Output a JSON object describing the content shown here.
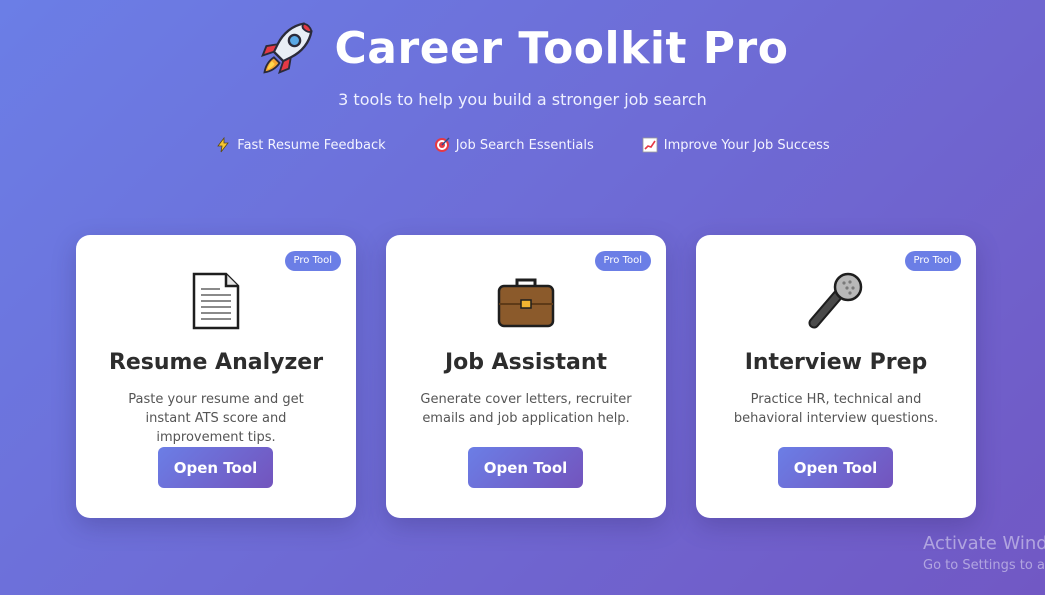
{
  "header": {
    "title": "Career Toolkit Pro",
    "title_icon": "rocket-icon",
    "subtitle": "3 tools to help you build a stronger job search"
  },
  "features": [
    {
      "icon": "lightning-icon",
      "label": "Fast Resume Feedback"
    },
    {
      "icon": "target-icon",
      "label": "Job Search Essentials"
    },
    {
      "icon": "chart-up-icon",
      "label": "Improve Your Job Success"
    }
  ],
  "cards": [
    {
      "badge": "Pro Tool",
      "icon": "document-icon",
      "title": "Resume Analyzer",
      "description": "Paste your resume and get instant ATS score and improvement tips.",
      "button": "Open Tool"
    },
    {
      "badge": "Pro Tool",
      "icon": "briefcase-icon",
      "title": "Job Assistant",
      "description": "Generate cover letters, recruiter emails and job application help.",
      "button": "Open Tool"
    },
    {
      "badge": "Pro Tool",
      "icon": "microphone-icon",
      "title": "Interview Prep",
      "description": "Practice HR, technical and behavioral interview questions.",
      "button": "Open Tool"
    }
  ],
  "watermark": {
    "line1": "Activate Wind",
    "line2": "Go to Settings to a"
  },
  "colors": {
    "gradient_start": "#6b7ee6",
    "gradient_end": "#7158c4",
    "badge": "#6b7ee6",
    "card_bg": "#ffffff"
  }
}
